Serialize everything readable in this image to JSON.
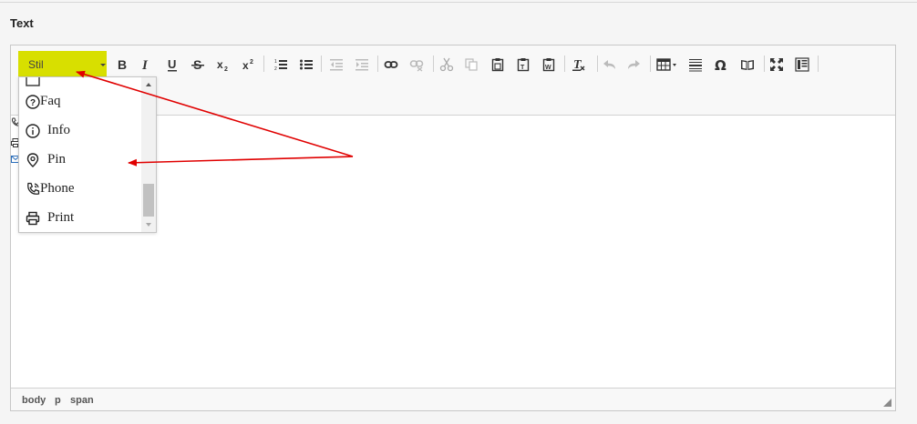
{
  "field": {
    "label": "Text"
  },
  "toolbar": {
    "style_combo": {
      "label": "Stil",
      "highlight_color": "#d8df00"
    }
  },
  "style_dropdown": {
    "items": [
      {
        "label": "Faq",
        "icon": "question-circle-icon"
      },
      {
        "label": "Info",
        "icon": "info-circle-icon"
      },
      {
        "label": "Pin",
        "icon": "map-pin-icon"
      },
      {
        "label": "Phone",
        "icon": "phone-icon"
      },
      {
        "label": "Print",
        "icon": "printer-icon"
      }
    ]
  },
  "statusbar": {
    "path": [
      "body",
      "p",
      "span"
    ]
  },
  "annotation": {
    "arrow_color": "#e00000"
  }
}
